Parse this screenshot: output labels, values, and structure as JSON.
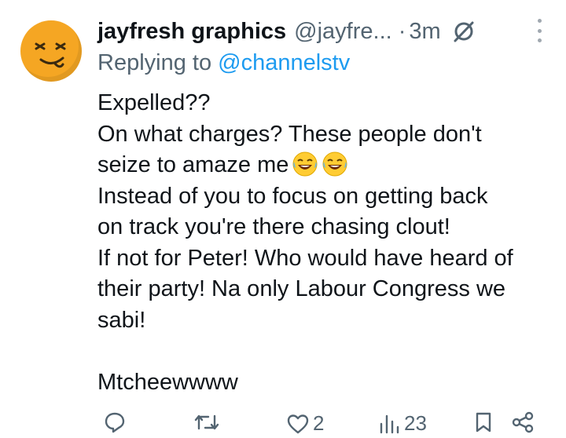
{
  "tweet": {
    "author_name": "jayfresh graphics",
    "author_handle": "@jayfre...",
    "separator": "·",
    "time": "3m",
    "replying_prefix": "Replying to ",
    "replying_mention": "@channelstv",
    "body_lines": [
      "Expelled??",
      "On what charges? These people don't",
      "seize to amaze me",
      "Instead of you to focus on getting back",
      "on track you're there chasing clout!",
      "If not for Peter! Who would have heard of",
      "their party! Na only Labour Congress we",
      "sabi!",
      "",
      "Mtcheewwww"
    ],
    "emojis": [
      "laughing-crying-emoji",
      "laughing-crying-emoji"
    ],
    "likes_count": "2",
    "views_count": "23",
    "avatar_color": "#f5a623",
    "accent_color": "#1d9bf0",
    "muted_color": "#536471"
  }
}
